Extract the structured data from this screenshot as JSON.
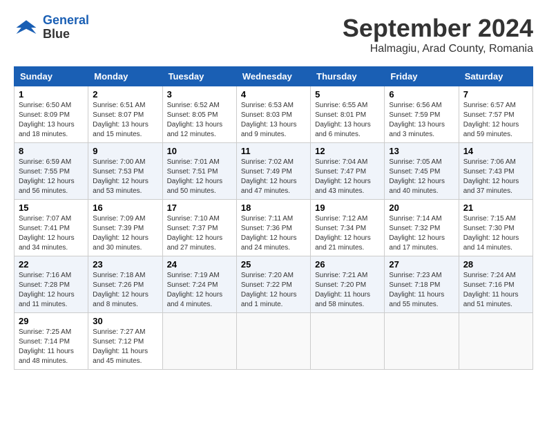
{
  "logo": {
    "line1": "General",
    "line2": "Blue"
  },
  "title": "September 2024",
  "location": "Halmagiu, Arad County, Romania",
  "headers": [
    "Sunday",
    "Monday",
    "Tuesday",
    "Wednesday",
    "Thursday",
    "Friday",
    "Saturday"
  ],
  "weeks": [
    [
      {
        "day": "1",
        "sunrise": "6:50 AM",
        "sunset": "8:09 PM",
        "daylight": "13 hours and 18 minutes."
      },
      {
        "day": "2",
        "sunrise": "6:51 AM",
        "sunset": "8:07 PM",
        "daylight": "13 hours and 15 minutes."
      },
      {
        "day": "3",
        "sunrise": "6:52 AM",
        "sunset": "8:05 PM",
        "daylight": "13 hours and 12 minutes."
      },
      {
        "day": "4",
        "sunrise": "6:53 AM",
        "sunset": "8:03 PM",
        "daylight": "13 hours and 9 minutes."
      },
      {
        "day": "5",
        "sunrise": "6:55 AM",
        "sunset": "8:01 PM",
        "daylight": "13 hours and 6 minutes."
      },
      {
        "day": "6",
        "sunrise": "6:56 AM",
        "sunset": "7:59 PM",
        "daylight": "13 hours and 3 minutes."
      },
      {
        "day": "7",
        "sunrise": "6:57 AM",
        "sunset": "7:57 PM",
        "daylight": "12 hours and 59 minutes."
      }
    ],
    [
      {
        "day": "8",
        "sunrise": "6:59 AM",
        "sunset": "7:55 PM",
        "daylight": "12 hours and 56 minutes."
      },
      {
        "day": "9",
        "sunrise": "7:00 AM",
        "sunset": "7:53 PM",
        "daylight": "12 hours and 53 minutes."
      },
      {
        "day": "10",
        "sunrise": "7:01 AM",
        "sunset": "7:51 PM",
        "daylight": "12 hours and 50 minutes."
      },
      {
        "day": "11",
        "sunrise": "7:02 AM",
        "sunset": "7:49 PM",
        "daylight": "12 hours and 47 minutes."
      },
      {
        "day": "12",
        "sunrise": "7:04 AM",
        "sunset": "7:47 PM",
        "daylight": "12 hours and 43 minutes."
      },
      {
        "day": "13",
        "sunrise": "7:05 AM",
        "sunset": "7:45 PM",
        "daylight": "12 hours and 40 minutes."
      },
      {
        "day": "14",
        "sunrise": "7:06 AM",
        "sunset": "7:43 PM",
        "daylight": "12 hours and 37 minutes."
      }
    ],
    [
      {
        "day": "15",
        "sunrise": "7:07 AM",
        "sunset": "7:41 PM",
        "daylight": "12 hours and 34 minutes."
      },
      {
        "day": "16",
        "sunrise": "7:09 AM",
        "sunset": "7:39 PM",
        "daylight": "12 hours and 30 minutes."
      },
      {
        "day": "17",
        "sunrise": "7:10 AM",
        "sunset": "7:37 PM",
        "daylight": "12 hours and 27 minutes."
      },
      {
        "day": "18",
        "sunrise": "7:11 AM",
        "sunset": "7:36 PM",
        "daylight": "12 hours and 24 minutes."
      },
      {
        "day": "19",
        "sunrise": "7:12 AM",
        "sunset": "7:34 PM",
        "daylight": "12 hours and 21 minutes."
      },
      {
        "day": "20",
        "sunrise": "7:14 AM",
        "sunset": "7:32 PM",
        "daylight": "12 hours and 17 minutes."
      },
      {
        "day": "21",
        "sunrise": "7:15 AM",
        "sunset": "7:30 PM",
        "daylight": "12 hours and 14 minutes."
      }
    ],
    [
      {
        "day": "22",
        "sunrise": "7:16 AM",
        "sunset": "7:28 PM",
        "daylight": "12 hours and 11 minutes."
      },
      {
        "day": "23",
        "sunrise": "7:18 AM",
        "sunset": "7:26 PM",
        "daylight": "12 hours and 8 minutes."
      },
      {
        "day": "24",
        "sunrise": "7:19 AM",
        "sunset": "7:24 PM",
        "daylight": "12 hours and 4 minutes."
      },
      {
        "day": "25",
        "sunrise": "7:20 AM",
        "sunset": "7:22 PM",
        "daylight": "12 hours and 1 minute."
      },
      {
        "day": "26",
        "sunrise": "7:21 AM",
        "sunset": "7:20 PM",
        "daylight": "11 hours and 58 minutes."
      },
      {
        "day": "27",
        "sunrise": "7:23 AM",
        "sunset": "7:18 PM",
        "daylight": "11 hours and 55 minutes."
      },
      {
        "day": "28",
        "sunrise": "7:24 AM",
        "sunset": "7:16 PM",
        "daylight": "11 hours and 51 minutes."
      }
    ],
    [
      {
        "day": "29",
        "sunrise": "7:25 AM",
        "sunset": "7:14 PM",
        "daylight": "11 hours and 48 minutes."
      },
      {
        "day": "30",
        "sunrise": "7:27 AM",
        "sunset": "7:12 PM",
        "daylight": "11 hours and 45 minutes."
      },
      null,
      null,
      null,
      null,
      null
    ]
  ],
  "labels": {
    "sunrise": "Sunrise:",
    "sunset": "Sunset:",
    "daylight": "Daylight:"
  }
}
